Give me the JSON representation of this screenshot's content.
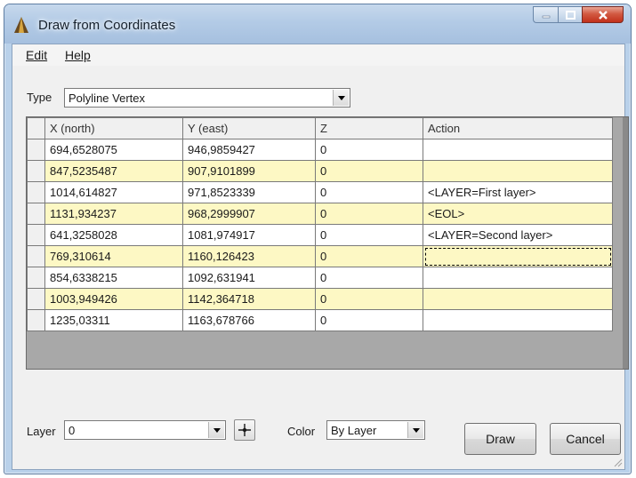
{
  "window": {
    "title": "Draw from Coordinates"
  },
  "menu": {
    "items": [
      "Edit",
      "Help"
    ]
  },
  "type_field": {
    "label": "Type",
    "value": "Polyline Vertex"
  },
  "grid": {
    "columns": [
      "X (north)",
      "Y (east)",
      "Z",
      "Action"
    ],
    "rows": [
      [
        "694,6528075",
        "946,9859427",
        "0",
        ""
      ],
      [
        "847,5235487",
        "907,9101899",
        "0",
        ""
      ],
      [
        "1014,614827",
        "971,8523339",
        "0",
        "<LAYER=First layer>"
      ],
      [
        "1131,934237",
        "968,2999907",
        "0",
        "<EOL>"
      ],
      [
        "641,3258028",
        "1081,974917",
        "0",
        "<LAYER=Second layer>"
      ],
      [
        "769,310614",
        "1160,126423",
        "0",
        ""
      ],
      [
        "854,6338215",
        "1092,631941",
        "0",
        ""
      ],
      [
        "1003,949426",
        "1142,364718",
        "0",
        ""
      ],
      [
        "1235,03311",
        "1163,678766",
        "0",
        ""
      ]
    ]
  },
  "layer_field": {
    "label": "Layer",
    "value": "0"
  },
  "color_field": {
    "label": "Color",
    "value": "By Layer"
  },
  "buttons": {
    "draw": "Draw",
    "cancel": "Cancel"
  },
  "icons": {
    "app": "pyramid-app-icon",
    "pick": "crosshair-pick-icon",
    "dropdown": "chevron-down-icon"
  }
}
